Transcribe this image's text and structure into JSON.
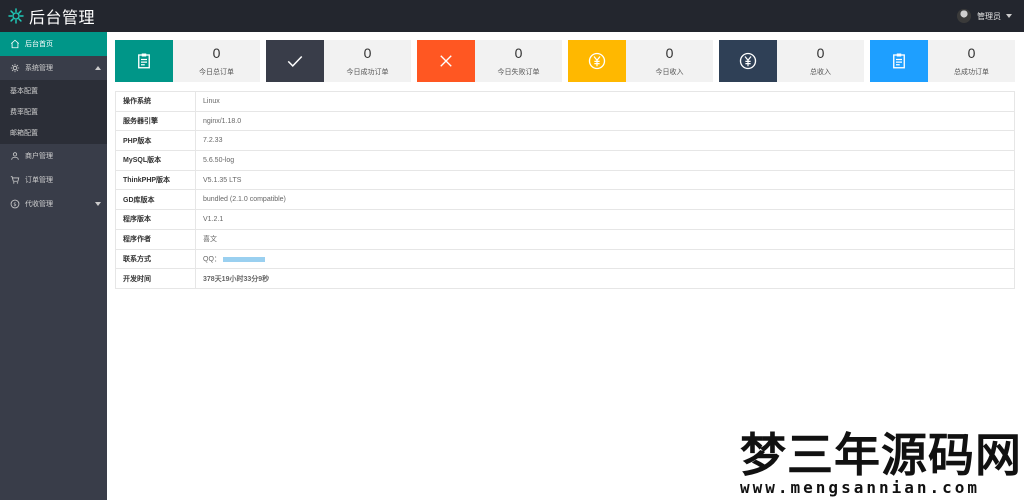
{
  "header": {
    "title": "后台管理",
    "username": "管理员",
    "logo_icon": "gear-icon"
  },
  "sidebar": {
    "items": [
      {
        "label": "后台首页",
        "icon": "home-icon",
        "active": true
      },
      {
        "label": "系统管理",
        "icon": "settings-icon",
        "expanded": true,
        "children": [
          "基本配置",
          "费率配置",
          "邮箱配置"
        ]
      },
      {
        "label": "商户管理",
        "icon": "user-icon"
      },
      {
        "label": "订单管理",
        "icon": "cart-icon"
      },
      {
        "label": "代收管理",
        "icon": "dollar-icon",
        "expandable": true
      }
    ]
  },
  "stats": [
    {
      "value": "0",
      "label": "今日总订单",
      "color": "#009688",
      "icon": "clipboard-icon"
    },
    {
      "value": "0",
      "label": "今日成功订单",
      "color": "#393d49",
      "icon": "check-icon"
    },
    {
      "value": "0",
      "label": "今日失败订单",
      "color": "#ff5722",
      "icon": "close-icon"
    },
    {
      "value": "0",
      "label": "今日收入",
      "color": "#ffb800",
      "icon": "yuan-icon"
    },
    {
      "value": "0",
      "label": "总收入",
      "color": "#2f4056",
      "icon": "yuan-icon"
    },
    {
      "value": "0",
      "label": "总成功订单",
      "color": "#1e9fff",
      "icon": "clipboard-icon"
    }
  ],
  "info_table": [
    {
      "key": "操作系统",
      "value": "Linux"
    },
    {
      "key": "服务器引擎",
      "value": "nginx/1.18.0"
    },
    {
      "key": "PHP版本",
      "value": "7.2.33"
    },
    {
      "key": "MySQL版本",
      "value": "5.6.50-log"
    },
    {
      "key": "ThinkPHP版本",
      "value": "V5.1.35 LTS"
    },
    {
      "key": "GD库版本",
      "value": "bundled (2.1.0 compatible)"
    },
    {
      "key": "程序版本",
      "value": "V1.2.1"
    },
    {
      "key": "程序作者",
      "value": "喜文"
    },
    {
      "key": "联系方式",
      "value": "QQ："
    },
    {
      "key": "开发时间",
      "value": "378天19小时33分9秒"
    }
  ],
  "watermark": {
    "title": "梦三年源码网",
    "url": "www.mengsannian.com"
  }
}
